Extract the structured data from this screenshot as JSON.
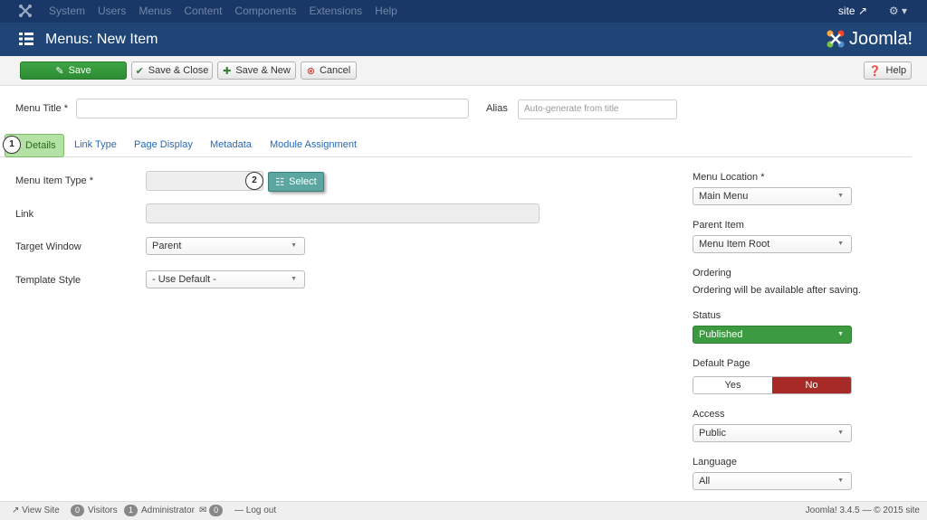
{
  "topnav": {
    "menu": [
      "System",
      "Users",
      "Menus",
      "Content",
      "Components",
      "Extensions",
      "Help"
    ],
    "site_label": "site",
    "gear_label": "⚙ ▾"
  },
  "header": {
    "title": "Menus: New Item",
    "brand": "Joomla!"
  },
  "toolbar": {
    "save": "Save",
    "save_close": "Save & Close",
    "save_new": "Save & New",
    "cancel": "Cancel",
    "help": "Help"
  },
  "form": {
    "menu_title_label": "Menu Title *",
    "menu_title_value": "",
    "alias_label": "Alias",
    "alias_placeholder": "Auto-generate from title"
  },
  "tabs": [
    "Details",
    "Link Type",
    "Page Display",
    "Metadata",
    "Module Assignment"
  ],
  "markers": [
    "1",
    "2"
  ],
  "details": {
    "menu_item_type_label": "Menu Item Type *",
    "select_label": "Select",
    "link_label": "Link",
    "target_window_label": "Target Window",
    "target_window_value": "Parent",
    "template_style_label": "Template Style",
    "template_style_value": "- Use Default -"
  },
  "sidebar": {
    "menu_location_label": "Menu Location *",
    "menu_location_value": "Main Menu",
    "parent_item_label": "Parent Item",
    "parent_item_value": "Menu Item Root",
    "ordering_label": "Ordering",
    "ordering_note": "Ordering will be available after saving.",
    "status_label": "Status",
    "status_value": "Published",
    "default_page_label": "Default Page",
    "default_yes": "Yes",
    "default_no": "No",
    "access_label": "Access",
    "access_value": "Public",
    "language_label": "Language",
    "language_value": "All"
  },
  "footer": {
    "view_site": "View Site",
    "visitors_count": "0",
    "visitors": "Visitors",
    "admin_count": "1",
    "administrator": "Administrator",
    "messages_count": "0",
    "logout": "Log out",
    "version": "Joomla! 3.4.5 — © 2015 site"
  },
  "colors": {
    "topnav": "#1a3867",
    "header": "#1f4577",
    "save_green": "#2d8b33",
    "published_green": "#3c9a40",
    "no_red": "#a72a26",
    "select_teal": "#5ba6a1"
  }
}
